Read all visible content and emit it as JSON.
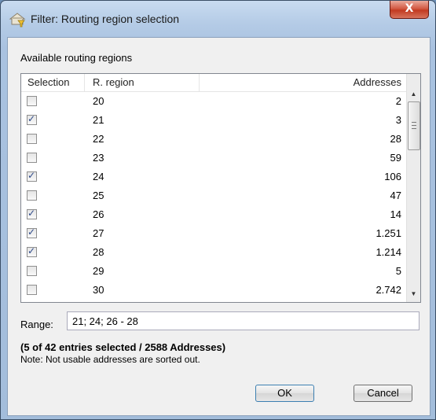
{
  "window": {
    "title": "Filter: Routing region selection",
    "close_label": "X"
  },
  "panel": {
    "available_label": "Available routing regions"
  },
  "list": {
    "headers": {
      "selection": "Selection",
      "region": "R. region",
      "addresses": "Addresses"
    },
    "rows": [
      {
        "region": "20",
        "addresses": "2",
        "checked": false
      },
      {
        "region": "21",
        "addresses": "3",
        "checked": true
      },
      {
        "region": "22",
        "addresses": "28",
        "checked": false
      },
      {
        "region": "23",
        "addresses": "59",
        "checked": false
      },
      {
        "region": "24",
        "addresses": "106",
        "checked": true
      },
      {
        "region": "25",
        "addresses": "47",
        "checked": false
      },
      {
        "region": "26",
        "addresses": "14",
        "checked": true
      },
      {
        "region": "27",
        "addresses": "1.251",
        "checked": true
      },
      {
        "region": "28",
        "addresses": "1.214",
        "checked": true
      },
      {
        "region": "29",
        "addresses": "5",
        "checked": false
      },
      {
        "region": "30",
        "addresses": "2.742",
        "checked": false
      }
    ]
  },
  "range": {
    "label": "Range:",
    "value": "21; 24; 26 - 28"
  },
  "summary": "(5 of 42 entries selected / 2588 Addresses)",
  "note": "Note: Not usable addresses are sorted out.",
  "buttons": {
    "ok": "OK",
    "cancel": "Cancel"
  },
  "colors": {
    "accent": "#3c7fb1",
    "check": "#2e4a8a",
    "close": "#c23a21"
  }
}
